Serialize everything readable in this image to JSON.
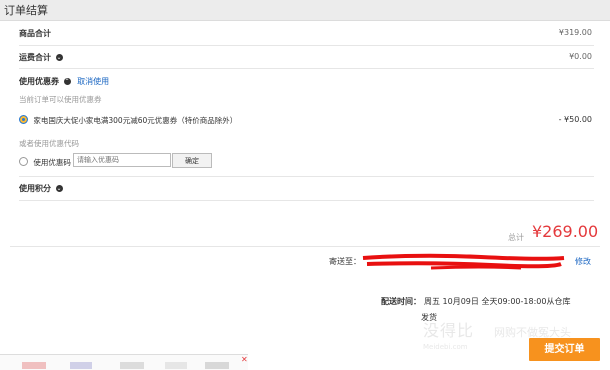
{
  "header": {
    "title": "订单结算"
  },
  "summary": {
    "goods_label": "商品合计",
    "goods_value": "¥319.00",
    "shipping_label": "运费合计",
    "shipping_value": "¥0.00"
  },
  "coupon": {
    "section_label": "使用优惠券",
    "cancel_label": "取消使用",
    "hint": "当前订单可以使用优惠券",
    "item_label": "家电国庆大促小家电满300元减60元优惠券（特价商品除外）",
    "item_value": "- ¥50.00",
    "or_code_hint": "或者使用优惠代码",
    "code_option_label": "使用优惠码",
    "code_placeholder": "请输入优惠码",
    "confirm_label": "确定"
  },
  "points": {
    "label": "使用积分"
  },
  "total": {
    "label": "总计",
    "value": "¥269.00"
  },
  "shipping": {
    "label": "寄送至：",
    "edit_label": "修改",
    "delivery_label": "配送时间：",
    "delivery_value": "周五 10月09日 全天09:00-18:00从仓库",
    "dispatch": "发货"
  },
  "watermark": {
    "main": "没得比",
    "side": "网购不做冤大头",
    "sub": "Meidebi.com"
  },
  "submit": {
    "label": "提交订单"
  },
  "icons": {
    "info": "circle-chevron-icon",
    "close": "close-icon"
  },
  "colors": {
    "price_red": "#e4393c",
    "submit_orange": "#f7921e",
    "link_blue": "#1a66c2"
  }
}
